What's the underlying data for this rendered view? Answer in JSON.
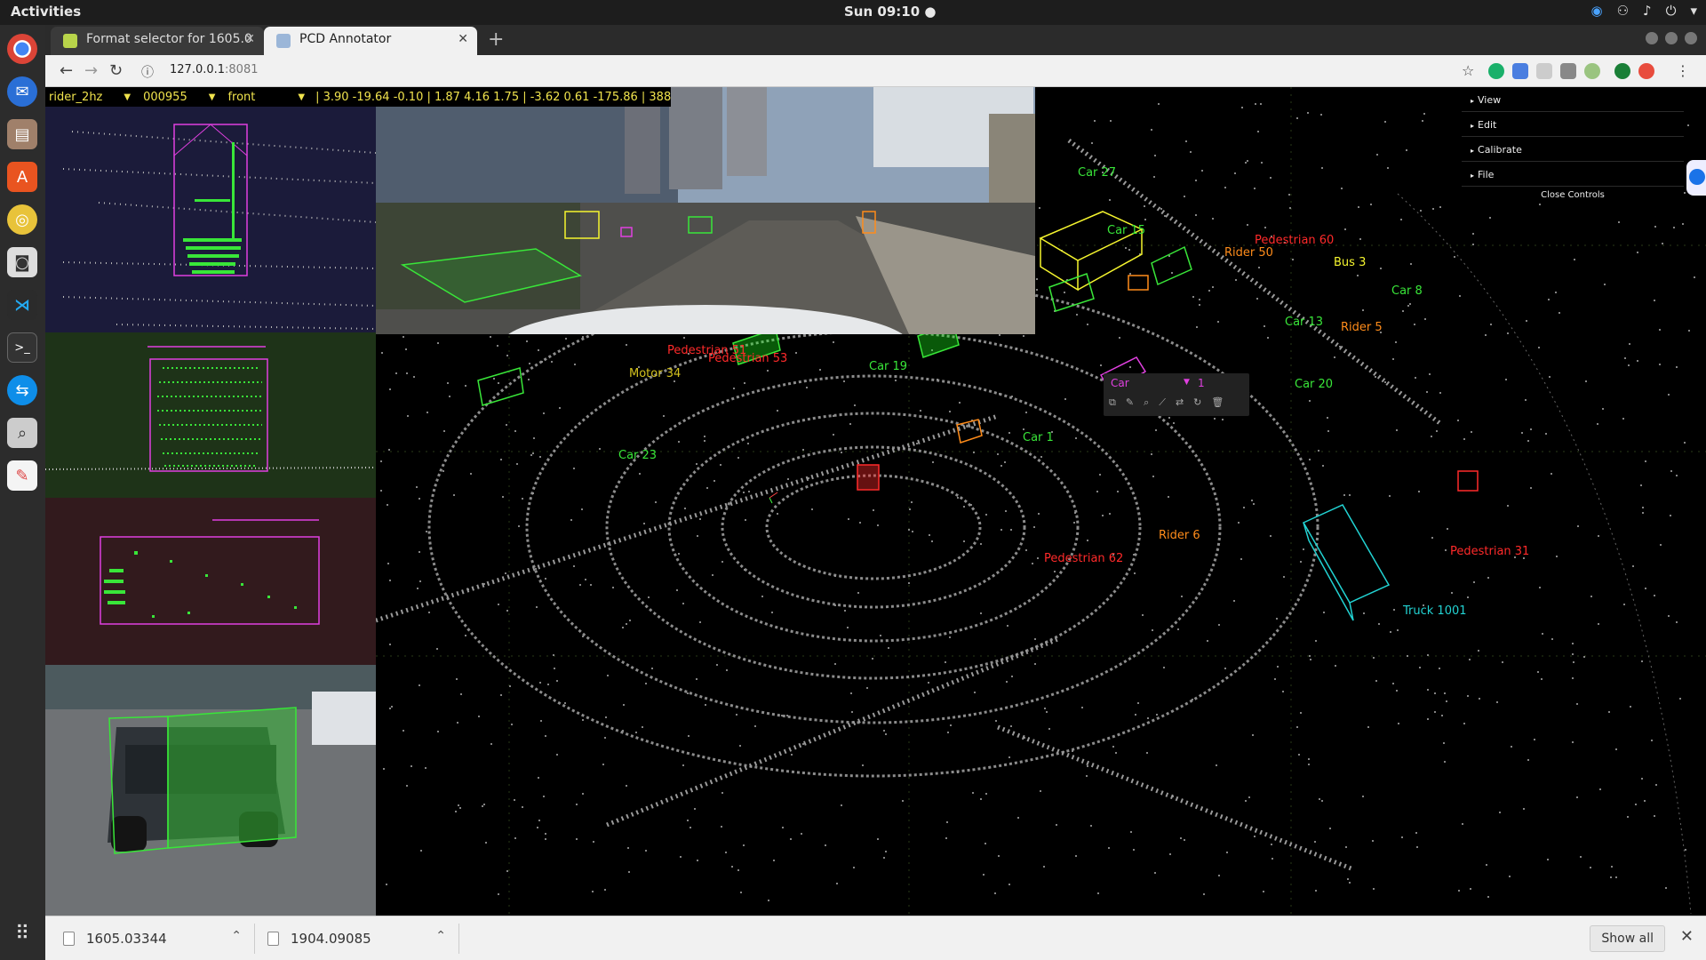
{
  "topbar": {
    "activities": "Activities",
    "clock": "Sun 09:10 ●"
  },
  "dock": {
    "items": [
      "chrome-icon",
      "thunderbird-icon",
      "files-icon",
      "software-icon",
      "rhythmbox-icon",
      "camera-icon",
      "vscode-icon",
      "terminal-icon",
      "teamviewer-icon",
      "screenshot-icon",
      "text-editor-icon"
    ]
  },
  "browser": {
    "tabs": [
      {
        "title": "Format selector for 1605.0",
        "active": false
      },
      {
        "title": "PCD Annotator",
        "active": true
      }
    ],
    "url_host": "127.0.0.1",
    "url_port": ":8081"
  },
  "annotator": {
    "scene_select": "rider_2hz",
    "frame_select": "000955",
    "camera_select": "front",
    "box_info": "| 3.90 -19.64 -0.10 | 1.87 4.16 1.75 | -3.62 0.61 -175.86 | 388",
    "controls": {
      "folders": [
        "View",
        "Edit",
        "Calibrate",
        "File"
      ],
      "close_label": "Close Controls"
    },
    "object_editor": {
      "type": "Car",
      "track_id": "1"
    },
    "labels": [
      {
        "text": "Car 27",
        "color": "#39e639"
      },
      {
        "text": "Car 15",
        "color": "#39e639"
      },
      {
        "text": "Pedestrian 60",
        "color": "#ff2a2a"
      },
      {
        "text": "Rider 50",
        "color": "#ff8c1a"
      },
      {
        "text": "Bus 3",
        "color": "#f5f52e"
      },
      {
        "text": "Car 8",
        "color": "#39e639"
      },
      {
        "text": "Car 13",
        "color": "#39e639"
      },
      {
        "text": "Rider 5",
        "color": "#ff8c1a"
      },
      {
        "text": "Car 20",
        "color": "#39e639"
      },
      {
        "text": "Pedestrian 51",
        "color": "#ff2a2a"
      },
      {
        "text": "Pedestrian 53",
        "color": "#ff2a2a"
      },
      {
        "text": "Motor 34",
        "color": "#d4c21e"
      },
      {
        "text": "Car 19",
        "color": "#39e639"
      },
      {
        "text": "Car 1",
        "color": "#39e639"
      },
      {
        "text": "Car 23",
        "color": "#39e639"
      },
      {
        "text": "Rider 6",
        "color": "#ff8c1a"
      },
      {
        "text": "Pedestrian 62",
        "color": "#ff2a2a"
      },
      {
        "text": "Pedestrian 31",
        "color": "#ff2a2a"
      },
      {
        "text": "Truck 1001",
        "color": "#22d3d3"
      }
    ]
  },
  "downloads": {
    "items": [
      "1605.03344",
      "1904.09085"
    ],
    "show_all": "Show all"
  }
}
